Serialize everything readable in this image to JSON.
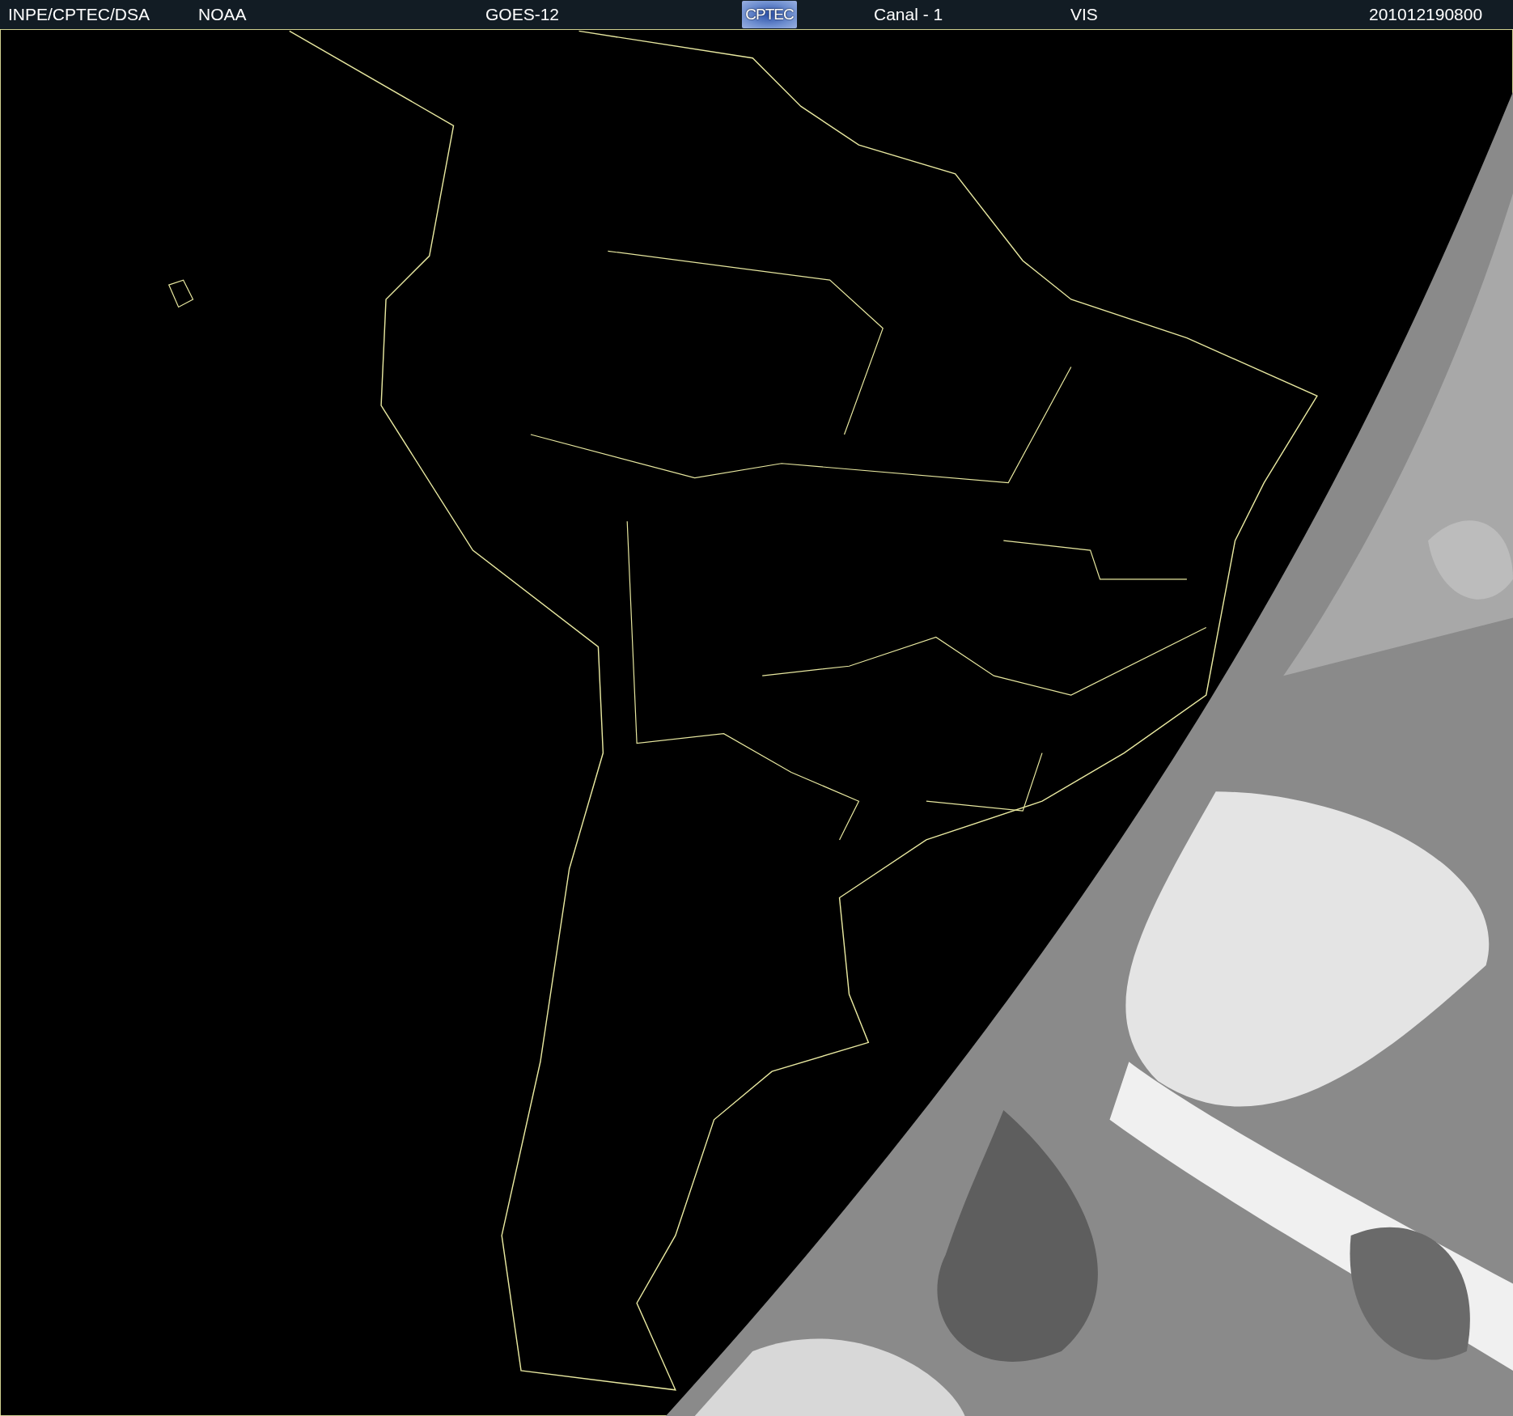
{
  "header": {
    "items": [
      {
        "kind": "text",
        "text": "INPE/CPTEC/DSA"
      },
      {
        "kind": "text",
        "text": "NOAA"
      },
      {
        "kind": "text",
        "text": "GOES-12"
      },
      {
        "kind": "logo",
        "text": "CPTEC"
      },
      {
        "kind": "text",
        "text": "Canal - 1"
      },
      {
        "kind": "text",
        "text": "VIS"
      },
      {
        "kind": "text",
        "text": "201012190800"
      }
    ]
  }
}
